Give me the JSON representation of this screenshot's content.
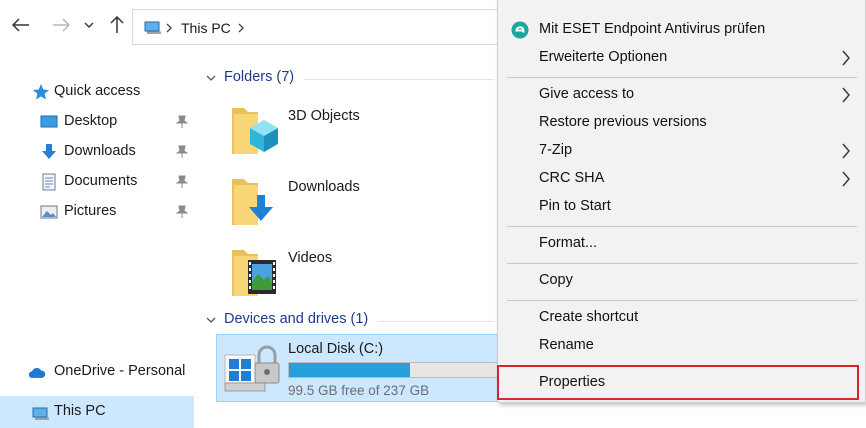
{
  "toolbar": {
    "back_icon": "back-arrow-icon",
    "forward_icon": "forward-arrow-icon",
    "recent_icon": "chevron-down-icon",
    "up_icon": "up-arrow-icon",
    "address": {
      "location": "This PC"
    }
  },
  "nav": {
    "quick_access": "Quick access",
    "items": [
      {
        "label": "Desktop",
        "icon": "desktop-icon"
      },
      {
        "label": "Downloads",
        "icon": "downloads-icon"
      },
      {
        "label": "Documents",
        "icon": "documents-icon"
      },
      {
        "label": "Pictures",
        "icon": "pictures-icon"
      }
    ],
    "onedrive": "OneDrive - Personal",
    "this_pc": "This PC"
  },
  "content": {
    "folders_header": "Folders (7)",
    "folders": [
      {
        "name": "3D Objects"
      },
      {
        "name": "Downloads"
      },
      {
        "name": "Videos"
      }
    ],
    "drives_header": "Devices and drives (1)",
    "drive": {
      "name": "Local Disk (C:)",
      "free_text": "99.5 GB free of 237 GB",
      "used_fraction": 0.58
    }
  },
  "context_menu": {
    "items": [
      {
        "label": "Mit ESET Endpoint Antivirus prüfen"
      },
      {
        "label": "Erweiterte Optionen"
      },
      {
        "label": "Give access to"
      },
      {
        "label": "Restore previous versions"
      },
      {
        "label": "7-Zip"
      },
      {
        "label": "CRC SHA"
      },
      {
        "label": "Pin to Start"
      },
      {
        "label": "Format..."
      },
      {
        "label": "Copy"
      },
      {
        "label": "Create shortcut"
      },
      {
        "label": "Rename"
      },
      {
        "label": "Properties"
      }
    ]
  },
  "colors": {
    "accent": "#0078d7",
    "selection": "#cce8ff",
    "highlight_box": "#d9252e",
    "progress": "#26a0da"
  }
}
